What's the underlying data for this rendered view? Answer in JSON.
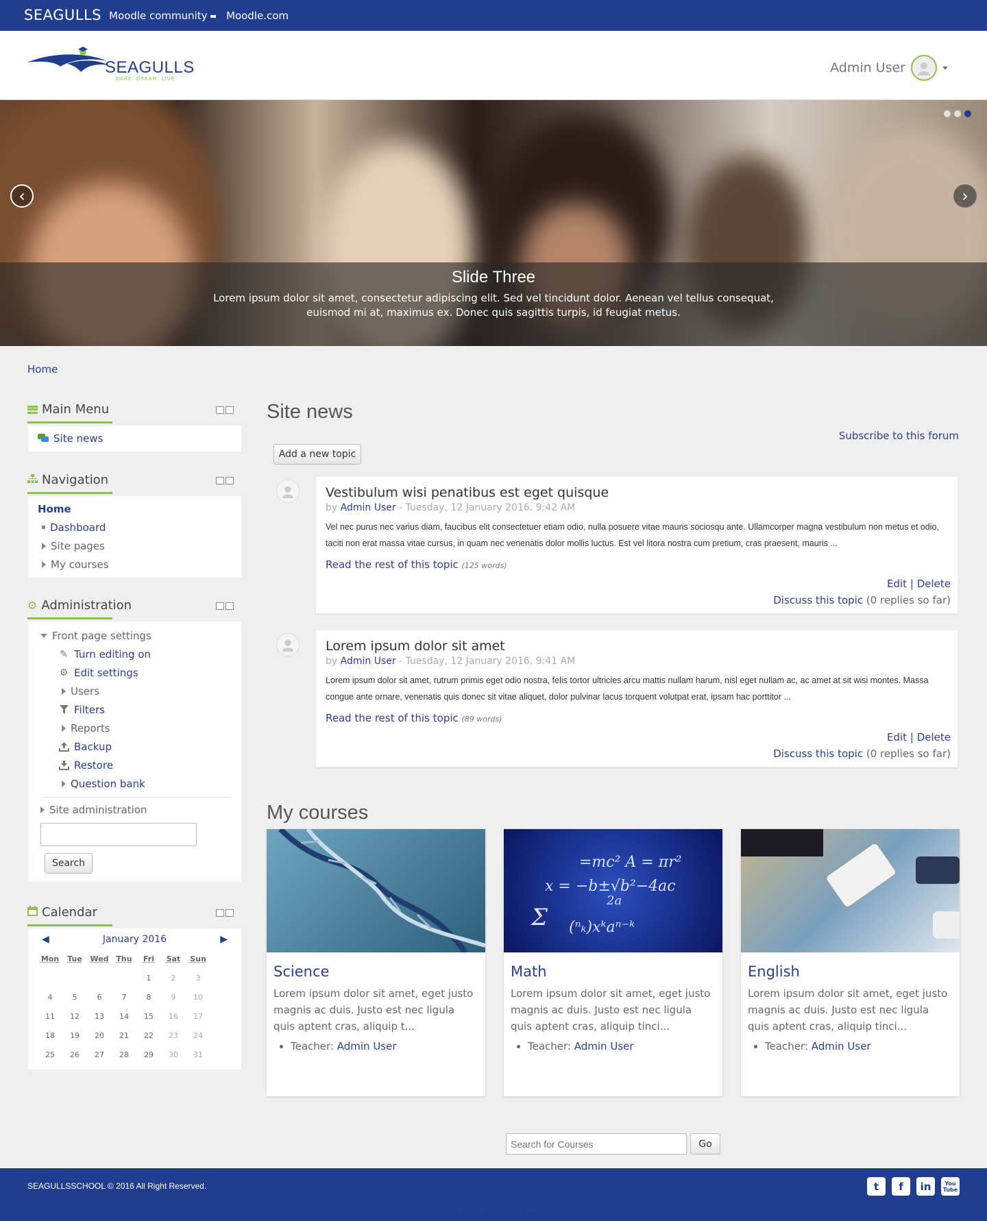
{
  "topbar": {
    "brand": "SEAGULLS",
    "nav": [
      "Moodle community",
      "Moodle.com"
    ]
  },
  "header": {
    "logo_text": "SEAGULLS",
    "logo_tagline": "DARE. DREAM. LIVE",
    "user_name": "Admin User"
  },
  "slider": {
    "title": "Slide Three",
    "text": "Lorem ipsum dolor sit amet, consectetur adipiscing elit. Sed vel tincidunt dolor. Aenean vel tellus consequat, euismod mi at, maximus ex. Donec quis sagittis turpis, id feugiat metus.",
    "prev": "‹",
    "next": "›"
  },
  "breadcrumb": "Home",
  "main_menu": {
    "title": "Main Menu",
    "items": [
      "Site news"
    ]
  },
  "navigation": {
    "title": "Navigation",
    "home": "Home",
    "items": [
      "Dashboard",
      "Site pages",
      "My courses"
    ]
  },
  "administration": {
    "title": "Administration",
    "front_page": "Front page settings",
    "items": [
      "Turn editing on",
      "Edit settings",
      "Users",
      "Filters",
      "Reports",
      "Backup",
      "Restore",
      "Question bank"
    ],
    "site_admin": "Site administration",
    "search_button": "Search"
  },
  "calendar": {
    "title": "Calendar",
    "month": "January 2016",
    "days": [
      "Mon",
      "Tue",
      "Wed",
      "Thu",
      "Fri",
      "Sat",
      "Sun"
    ],
    "weeks": [
      [
        "",
        "",
        "",
        "",
        "1",
        "2",
        "3"
      ],
      [
        "4",
        "5",
        "6",
        "7",
        "8",
        "9",
        "10"
      ],
      [
        "11",
        "12",
        "13",
        "14",
        "15",
        "16",
        "17"
      ],
      [
        "18",
        "19",
        "20",
        "21",
        "22",
        "23",
        "24"
      ],
      [
        "25",
        "26",
        "27",
        "28",
        "29",
        "30",
        "31"
      ]
    ]
  },
  "site_news": {
    "title": "Site news",
    "subscribe": "Subscribe to this forum",
    "add_topic": "Add a new topic",
    "posts": [
      {
        "title": "Vestibulum wisi penatibus est eget quisque",
        "by": "by",
        "author": "Admin User",
        "date": " - Tuesday, 12 January 2016, 9:42 AM",
        "body": " Vel nec purus nec varius diam, faucibus elit consectetuer etiam odio, nulla posuere vitae mauris sociosqu ante. Ullamcorper magna vestibulum non metus et odio, taciti non erat massa vitae cursus, in quam nec venenatis dolor mollis luctus. Est vel litora nostra cum pretium, cras praesent, mauris ...",
        "more": "Read the rest of this topic",
        "words": "(125 words)",
        "edit": "Edit",
        "sep": "|",
        "delete": "Delete",
        "discuss": "Discuss this topic",
        "replies": " (0 replies so far)"
      },
      {
        "title": "Lorem ipsum dolor sit amet",
        "by": "by",
        "author": "Admin User",
        "date": " - Tuesday, 12 January 2016, 9:41 AM",
        "body": "Lorem ipsum dolor sit amet, rutrum primis eget odio nostra, felis tortor ultricies arcu mattis nullam harum, nisl eget nullam ac, ac amet at sit wisi montes. Massa congue ante ornare, venenatis quis donec sit vitae aliquet, dolor pulvinar lacus torquent volutpat erat, ipsam hac porttitor ...",
        "more": "Read the rest of this topic",
        "words": "(89 words)",
        "edit": "Edit",
        "sep": "|",
        "delete": "Delete",
        "discuss": "Discuss this topic",
        "replies": " (0 replies so far)"
      }
    ]
  },
  "my_courses": {
    "title": "My courses",
    "courses": [
      {
        "name": "Science",
        "desc": "Lorem ipsum dolor sit amet, eget justo magnis ac duis. Justo est nec ligula quis aptent cras, aliquip t...",
        "teacher_label": "Teacher: ",
        "teacher": "Admin User"
      },
      {
        "name": "Math",
        "desc": "Lorem ipsum dolor sit amet, eget justo magnis ac duis. Justo est nec ligula quis aptent cras, aliquip tinci...",
        "teacher_label": "Teacher: ",
        "teacher": "Admin User"
      },
      {
        "name": "English",
        "desc": "Lorem ipsum dolor sit amet, eget justo magnis ac duis. Justo est nec ligula quis aptent cras, aliquip tinci...",
        "teacher_label": "Teacher: ",
        "teacher": "Admin User"
      }
    ]
  },
  "course_search": {
    "placeholder": "Search for Courses",
    "button": "Go"
  },
  "footer": {
    "copyright": "SEAGULLSSCHOOL © 2016 All Right Reserved.",
    "social": [
      "twitter-icon",
      "facebook-icon",
      "linkedin-icon",
      "youtube-icon"
    ],
    "purge": "Purge all caches"
  },
  "colors": {
    "brand": "#213e8e",
    "accent": "#8bc34a",
    "link": "#2b3f8e"
  }
}
